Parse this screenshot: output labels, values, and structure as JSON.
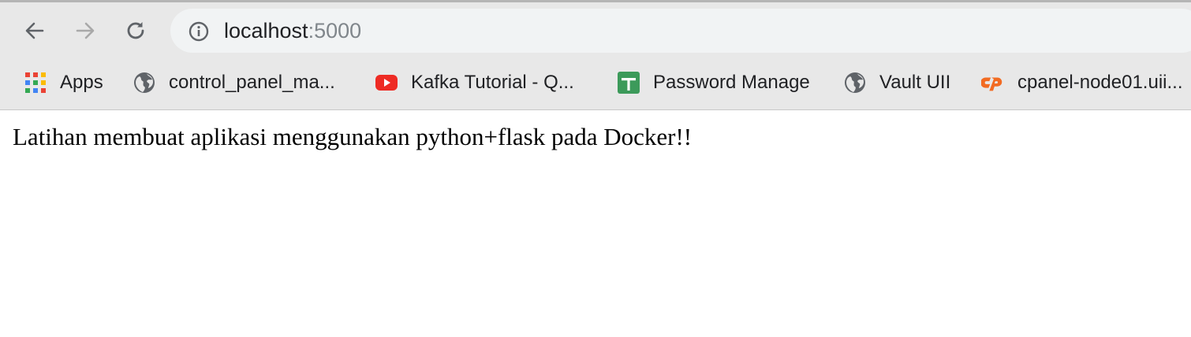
{
  "browser": {
    "url_host": "localhost",
    "url_port": ":5000",
    "nav": {
      "back_icon": "arrow-left-icon",
      "forward_icon": "arrow-right-icon",
      "reload_icon": "reload-icon"
    },
    "bookmarks": [
      {
        "label": "Apps",
        "icon": "apps-grid-icon"
      },
      {
        "label": "control_panel_ma...",
        "icon": "globe-icon"
      },
      {
        "label": "Kafka Tutorial - Q...",
        "icon": "youtube-icon"
      },
      {
        "label": "Password Manage",
        "icon": "sheets-icon"
      },
      {
        "label": "Vault UII",
        "icon": "globe-icon"
      },
      {
        "label": "cpanel-node01.uii...",
        "icon": "cpanel-icon"
      }
    ]
  },
  "page": {
    "text": "Latihan membuat aplikasi menggunakan python+flask pada Docker!!"
  },
  "colors": {
    "toolbar_bg": "#e8e8e8",
    "omnibox_bg": "#f1f3f4",
    "youtube_red": "#ff0000",
    "sheets_green": "#0f9d58",
    "cpanel_orange": "#ff6c2c"
  }
}
